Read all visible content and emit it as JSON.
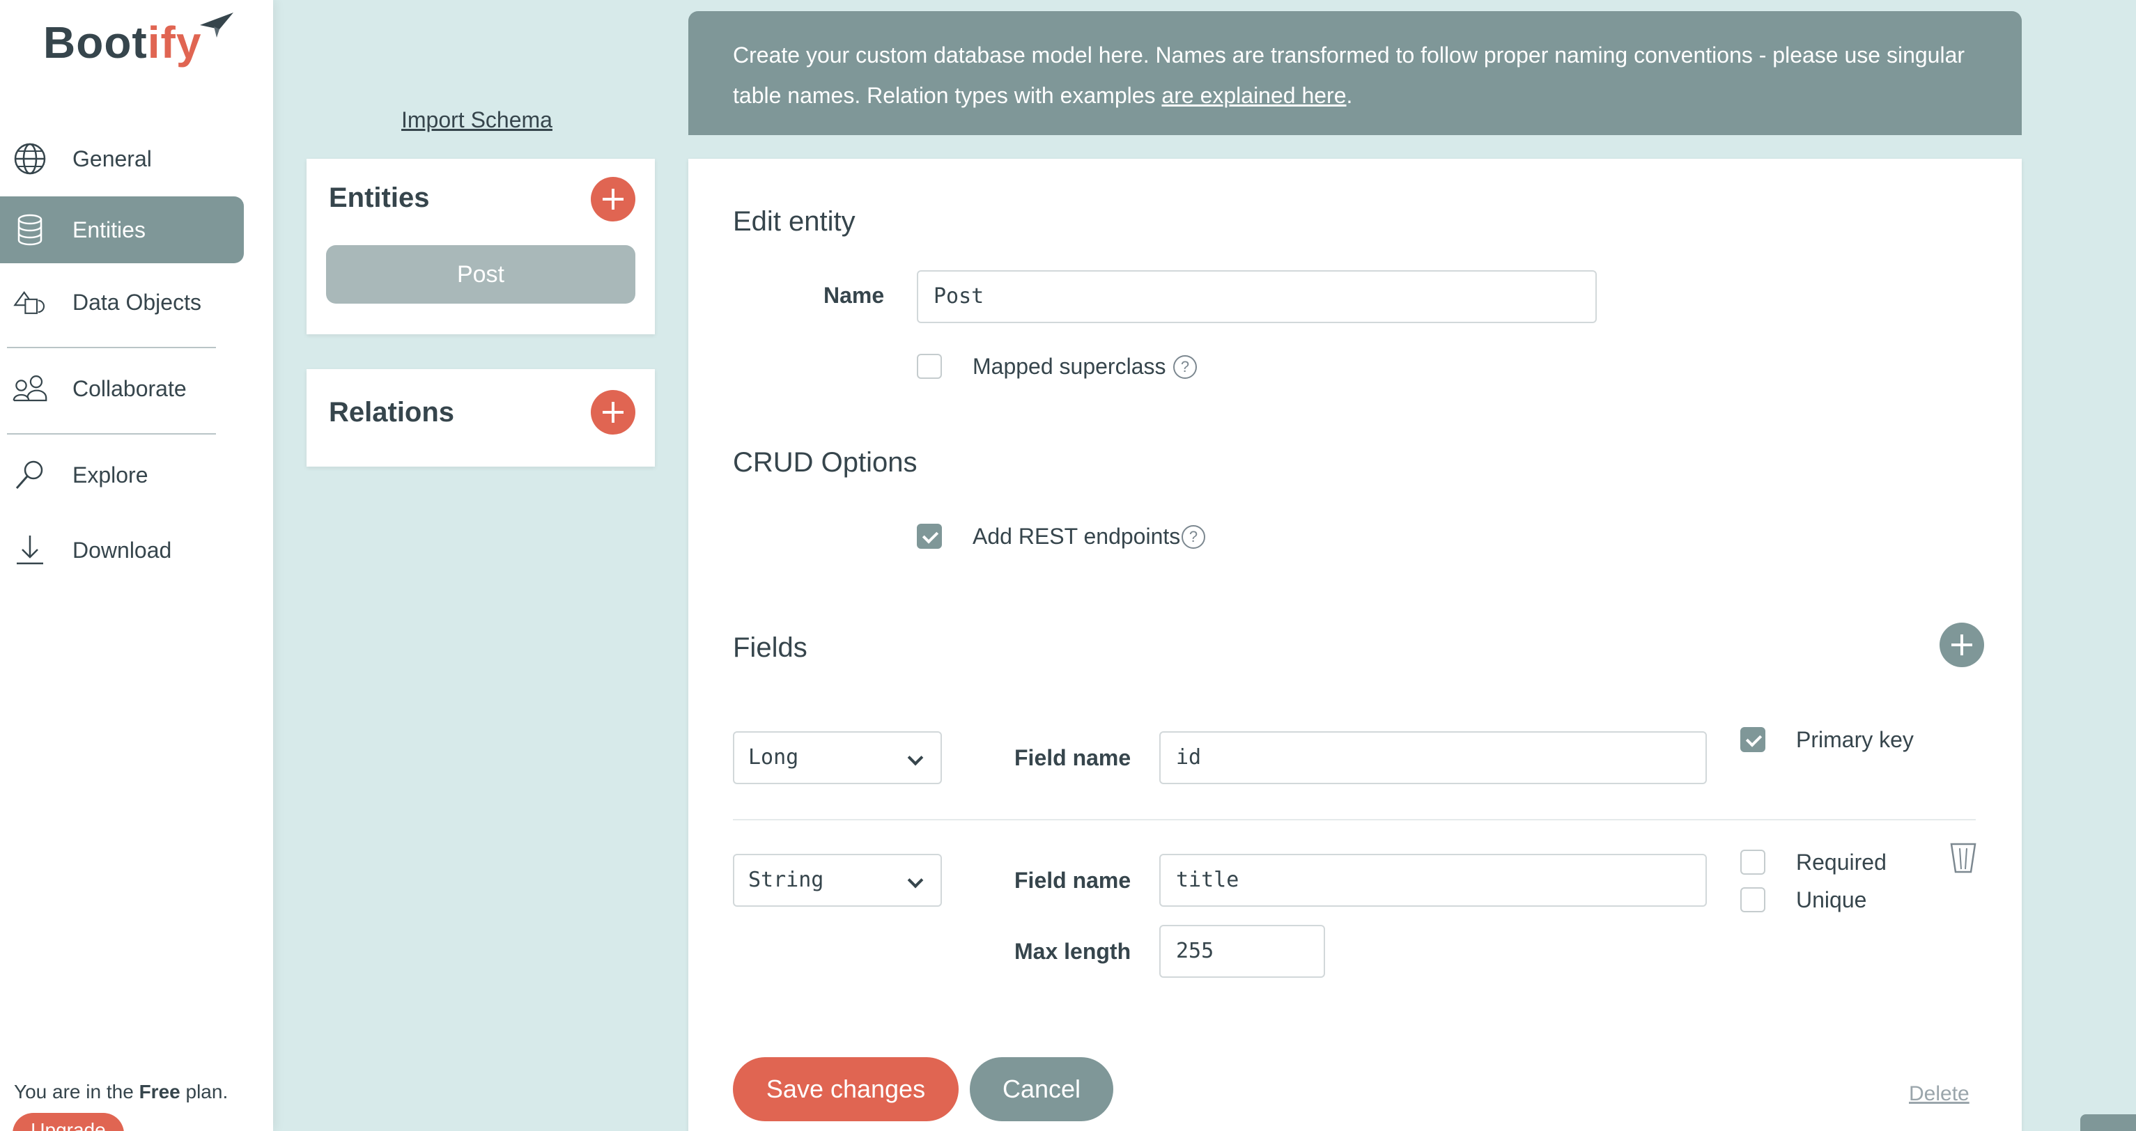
{
  "app": {
    "logo_main": "Boot",
    "logo_accent": "ify"
  },
  "sidebar": {
    "items": [
      {
        "label": "General",
        "icon": "globe-icon"
      },
      {
        "label": "Entities",
        "icon": "database-icon",
        "active": true
      },
      {
        "label": "Data Objects",
        "icon": "shapes-icon"
      },
      {
        "label": "Collaborate",
        "icon": "people-icon"
      },
      {
        "label": "Explore",
        "icon": "magnifier-icon"
      },
      {
        "label": "Download",
        "icon": "download-icon"
      }
    ],
    "plan_prefix": "You are in the",
    "plan_name": "Free",
    "plan_suffix": "plan.",
    "upgrade_label": "Upgrade"
  },
  "schema": {
    "import_label": "Import Schema",
    "entities_title": "Entities",
    "entities": [
      "Post"
    ],
    "relations_title": "Relations"
  },
  "banner": {
    "text": "Create your custom database model here. Names are transformed to follow proper naming conventions - please use singular table names. Relation types with examples",
    "link": "are explained here",
    "end": "."
  },
  "editor": {
    "title": "Edit entity",
    "name_label": "Name",
    "name_value": "Post",
    "mapped_superclass_label": "Mapped superclass",
    "mapped_superclass_checked": false,
    "crud_title": "CRUD Options",
    "rest_label": "Add REST endpoints",
    "rest_checked": true,
    "fields_title": "Fields",
    "field_name_label": "Field name",
    "max_length_label": "Max length",
    "fields": [
      {
        "type": "Long",
        "name": "id",
        "primary_key_label": "Primary key",
        "primary_key": true
      },
      {
        "type": "String",
        "name": "title",
        "required_label": "Required",
        "unique_label": "Unique",
        "max_length": "255"
      }
    ],
    "save_label": "Save changes",
    "cancel_label": "Cancel",
    "delete_label": "Delete"
  },
  "colors": {
    "accent": "#e06552",
    "primary": "#7f9798",
    "background": "#d7eaea",
    "text": "#36454c"
  }
}
